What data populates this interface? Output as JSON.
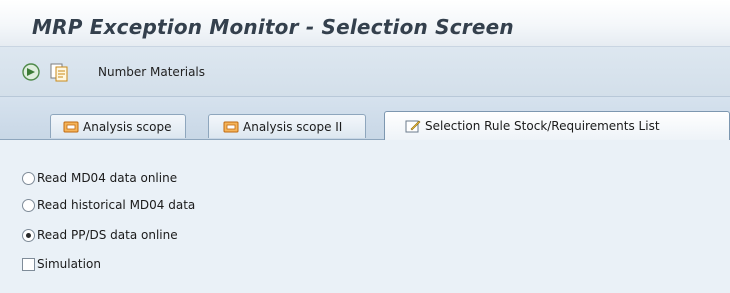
{
  "window": {
    "title": "MRP Exception Monitor - Selection Screen"
  },
  "toolbar": {
    "execute_icon": "execute-icon",
    "variant_icon": "get-variant-icon",
    "number_materials_label": "Number Materials"
  },
  "tabs": [
    {
      "label": "Analysis scope",
      "icon": "tab-scope-icon",
      "active": false
    },
    {
      "label": "Analysis scope II",
      "icon": "tab-scope-icon",
      "active": false
    },
    {
      "label": "Selection Rule Stock/Requirements List",
      "icon": "edit-tab-icon",
      "active": true
    }
  ],
  "options": {
    "read_md04_online": {
      "label": "Read MD04 data online",
      "selected": false
    },
    "read_historical_md04": {
      "label": "Read historical MD04 data",
      "selected": false
    },
    "read_ppds_online": {
      "label": "Read PP/DS data online",
      "selected": true
    },
    "simulation": {
      "label": "Simulation",
      "checked": false
    }
  },
  "colors": {
    "title_text": "#34404d",
    "toolbar_bg": "#d9e4ee",
    "content_bg": "#eaf1f7",
    "tab_border": "#8ea6bd"
  }
}
